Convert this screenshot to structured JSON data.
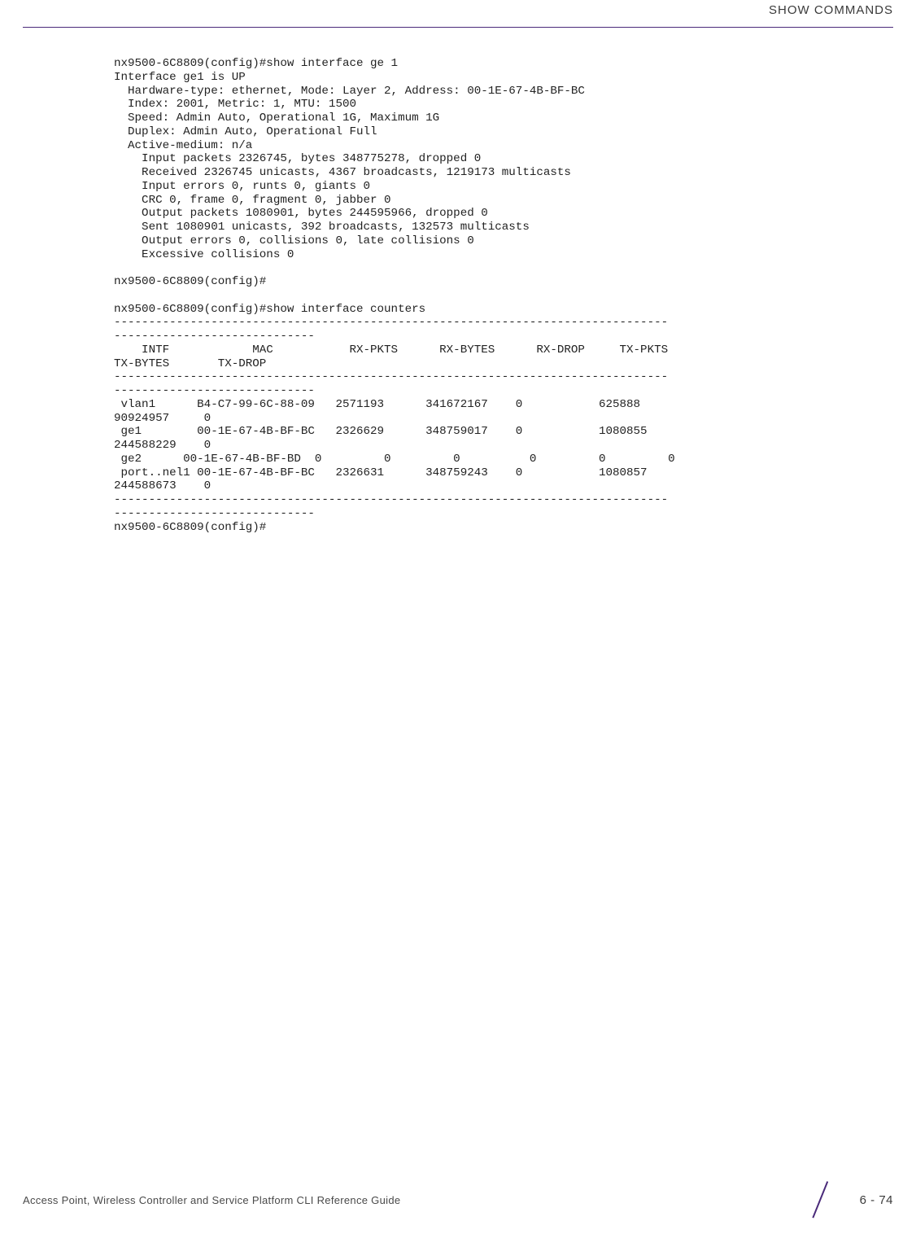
{
  "header": {
    "title": "SHOW COMMANDS"
  },
  "cli": {
    "block1_line1": "nx9500-6C8809(config)#show interface ge 1",
    "block1_line2": "Interface ge1 is UP",
    "block1_line3": "  Hardware-type: ethernet, Mode: Layer 2, Address: 00-1E-67-4B-BF-BC",
    "block1_line4": "  Index: 2001, Metric: 1, MTU: 1500",
    "block1_line5": "  Speed: Admin Auto, Operational 1G, Maximum 1G",
    "block1_line6": "  Duplex: Admin Auto, Operational Full",
    "block1_line7": "  Active-medium: n/a",
    "block1_line8": "    Input packets 2326745, bytes 348775278, dropped 0",
    "block1_line9": "    Received 2326745 unicasts, 4367 broadcasts, 1219173 multicasts",
    "block1_line10": "    Input errors 0, runts 0, giants 0",
    "block1_line11": "    CRC 0, frame 0, fragment 0, jabber 0",
    "block1_line12": "    Output packets 1080901, bytes 244595966, dropped 0",
    "block1_line13": "    Sent 1080901 unicasts, 392 broadcasts, 132573 multicasts",
    "block1_line14": "    Output errors 0, collisions 0, late collisions 0",
    "block1_line15": "    Excessive collisions 0",
    "blank1": "",
    "block2_line1": "nx9500-6C8809(config)#",
    "blank2": "",
    "block3_line1": "nx9500-6C8809(config)#show interface counters",
    "sep1a": "--------------------------------------------------------------------------------",
    "sep1b": "-----------------------------",
    "hdr1": "    INTF            MAC           RX-PKTS      RX-BYTES      RX-DROP     TX-PKTS    ",
    "hdr2": "TX-BYTES       TX-DROP",
    "sep2a": "--------------------------------------------------------------------------------",
    "sep2b": "-----------------------------",
    "row1a": " vlan1      B4-C7-99-6C-88-09   2571193      341672167    0           625888     ",
    "row1b": "90924957     0",
    "row2a": " ge1        00-1E-67-4B-BF-BC   2326629      348759017    0           1080855    ",
    "row2b": "244588229    0",
    "row3": " ge2      00-1E-67-4B-BF-BD  0         0         0          0         0         0",
    "row4a": " port..nel1 00-1E-67-4B-BF-BC   2326631      348759243    0           1080857    ",
    "row4b": "244588673    0",
    "sep3a": "--------------------------------------------------------------------------------",
    "sep3b": "-----------------------------",
    "block4_line1": "nx9500-6C8809(config)#"
  },
  "footer": {
    "text": "Access Point, Wireless Controller and Service Platform CLI Reference Guide",
    "page": "6 - 74"
  }
}
